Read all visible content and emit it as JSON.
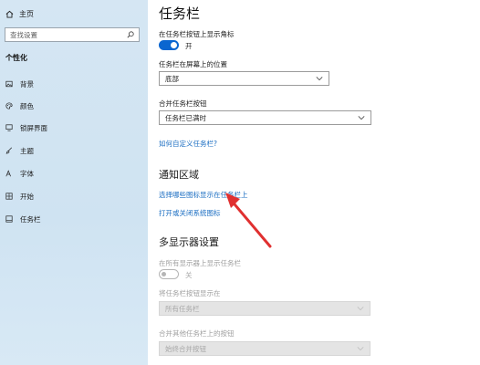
{
  "sidebar": {
    "home_label": "主页",
    "search_placeholder": "查找设置",
    "section_title": "个性化",
    "items": [
      {
        "label": "背景",
        "icon": "image-icon"
      },
      {
        "label": "颜色",
        "icon": "palette-icon"
      },
      {
        "label": "锁屏界面",
        "icon": "lock-screen-icon"
      },
      {
        "label": "主题",
        "icon": "brush-icon"
      },
      {
        "label": "字体",
        "icon": "font-icon"
      },
      {
        "label": "开始",
        "icon": "start-icon"
      },
      {
        "label": "任务栏",
        "icon": "taskbar-icon"
      }
    ]
  },
  "main": {
    "title": "任务栏",
    "badge_label": "在任务栏按钮上显示角标",
    "badge_toggle_text": "开",
    "badge_toggle_on": true,
    "position_label": "任务栏在屏幕上的位置",
    "position_value": "底部",
    "combine_label": "合并任务栏按钮",
    "combine_value": "任务栏已满时",
    "customize_link": "如何自定义任务栏?",
    "notification_heading": "通知区域",
    "select_icons_link": "选择哪些图标显示在任务栏上",
    "system_icons_link": "打开或关闭系统图标",
    "multi_display_heading": "多显示器设置",
    "show_all_label": "在所有显示器上显示任务栏",
    "show_all_toggle_text": "关",
    "show_all_toggle_on": false,
    "show_buttons_label": "将任务栏按钮显示在",
    "show_buttons_value": "所有任务栏",
    "combine_other_label": "合并其他任务栏上的按钮",
    "combine_other_value": "始终合并按钮"
  },
  "colors": {
    "accent": "#0a66d0",
    "link": "#1a6dc2",
    "annotation_arrow": "#e03030"
  }
}
